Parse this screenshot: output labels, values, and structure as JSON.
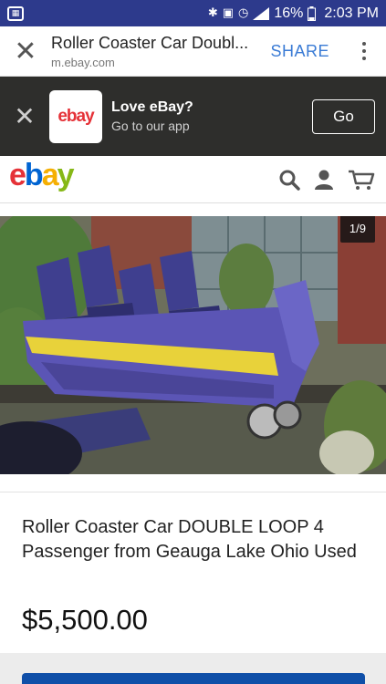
{
  "status_bar": {
    "battery": "16%",
    "time": "2:03 PM",
    "icons": [
      "bluetooth-icon",
      "nfc-icon",
      "alarm-icon",
      "signal-icon",
      "battery-icon"
    ]
  },
  "tab_bar": {
    "title": "Roller Coaster Car Doubl...",
    "url": "m.ebay.com",
    "share_label": "SHARE"
  },
  "app_banner": {
    "logo_text": "ebay",
    "title": "Love eBay?",
    "subtitle": "Go to our app",
    "go_label": "Go"
  },
  "header": {
    "logo_text": "ebay",
    "icons": [
      "search-icon",
      "user-icon",
      "cart-icon"
    ]
  },
  "gallery": {
    "counter": "1/9"
  },
  "item": {
    "title": "Roller Coaster Car DOUBLE LOOP 4 Passenger from Geauga Lake Ohio Used",
    "price": "$5,500.00"
  },
  "colors": {
    "status_bar": "#2d3a8c",
    "banner_bg": "#2e2e2c",
    "share_link": "#3a7bd5",
    "ebay_red": "#e53238",
    "ebay_blue": "#0064d2",
    "ebay_yellow": "#f5af02",
    "ebay_green": "#86b817",
    "buy_button": "#0f4fa8"
  }
}
